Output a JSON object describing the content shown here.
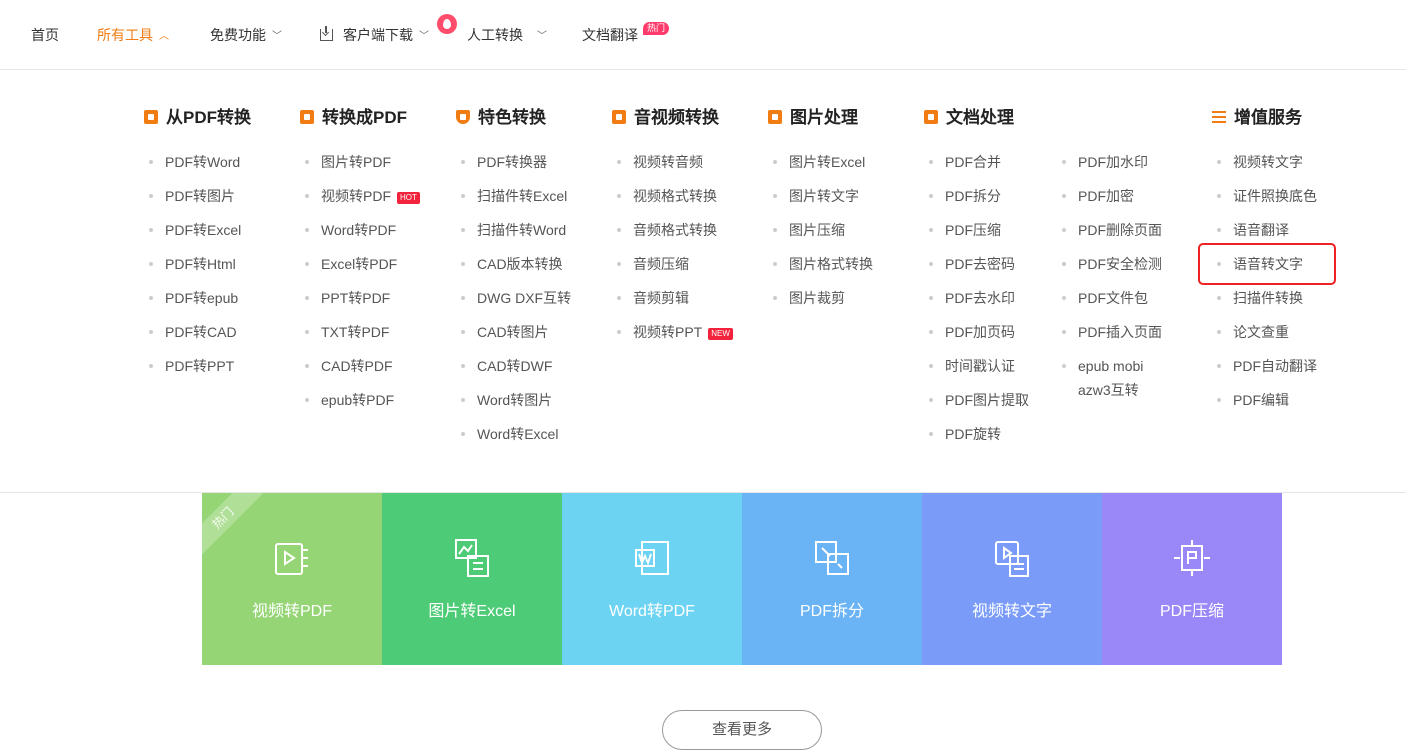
{
  "nav": {
    "home": "首页",
    "all_tools": "所有工具",
    "free_features": "免费功能",
    "client_download": "客户端下载",
    "manual_convert": "人工转换",
    "doc_translate": "文档翻译",
    "hot_badge": "热门"
  },
  "menu": {
    "columns": [
      {
        "title": "从PDF转换",
        "icon": "pdf-convert-icon",
        "items": [
          "PDF转Word",
          "PDF转图片",
          "PDF转Excel",
          "PDF转Html",
          "PDF转epub",
          "PDF转CAD",
          "PDF转PPT"
        ]
      },
      {
        "title": "转换成PDF",
        "icon": "to-pdf-icon",
        "items": [
          "图片转PDF",
          "视频转PDF",
          "Word转PDF",
          "Excel转PDF",
          "PPT转PDF",
          "TXT转PDF",
          "CAD转PDF",
          "epub转PDF"
        ],
        "tag_item": 1,
        "tag": "HOT"
      },
      {
        "title": "特色转换",
        "icon": "shield-icon",
        "items": [
          "PDF转换器",
          "扫描件转Excel",
          "扫描件转Word",
          "CAD版本转换",
          "DWG DXF互转",
          "CAD转图片",
          "CAD转DWF",
          "Word转图片",
          "Word转Excel"
        ]
      },
      {
        "title": "音视频转换",
        "icon": "video-icon",
        "items": [
          "视频转音频",
          "视频格式转换",
          "音频格式转换",
          "音频压缩",
          "音频剪辑",
          "视频转PPT"
        ],
        "tag_item": 5,
        "tag": "NEW"
      },
      {
        "title": "图片处理",
        "icon": "image-icon",
        "items": [
          "图片转Excel",
          "图片转文字",
          "图片压缩",
          "图片格式转换",
          "图片裁剪"
        ]
      },
      {
        "title": "文档处理",
        "icon": "document-icon",
        "items": [
          "PDF合并",
          "PDF拆分",
          "PDF压缩",
          "PDF去密码",
          "PDF去水印",
          "PDF加页码",
          "时间戳认证",
          "PDF图片提取",
          "PDF旋转"
        ]
      },
      {
        "title": "",
        "items": [
          "PDF加水印",
          "PDF加密",
          "PDF删除页面",
          "PDF安全检测",
          "PDF文件包",
          "PDF插入页面",
          "epub mobi azw3互转"
        ]
      },
      {
        "title": "增值服务",
        "icon": "list-icon",
        "items": [
          "视频转文字",
          "证件照换底色",
          "语音翻译",
          "语音转文字",
          "扫描件转换",
          "论文查重",
          "PDF自动翻译",
          "PDF编辑"
        ],
        "highlight_item": 3
      }
    ]
  },
  "tiles": [
    {
      "label": "视频转PDF",
      "color": "#96d575",
      "ribbon": "热门",
      "icon": "video-to-pdf-icon"
    },
    {
      "label": "图片转Excel",
      "color": "#4ecb76",
      "icon": "image-to-excel-icon"
    },
    {
      "label": "Word转PDF",
      "color": "#6dd3f2",
      "icon": "word-to-pdf-icon"
    },
    {
      "label": "PDF拆分",
      "color": "#6ab3f5",
      "icon": "pdf-split-icon"
    },
    {
      "label": "视频转文字",
      "color": "#7a9cf8",
      "icon": "video-to-text-icon"
    },
    {
      "label": "PDF压缩",
      "color": "#9b88f8",
      "icon": "pdf-compress-icon"
    }
  ],
  "more_button": "查看更多"
}
